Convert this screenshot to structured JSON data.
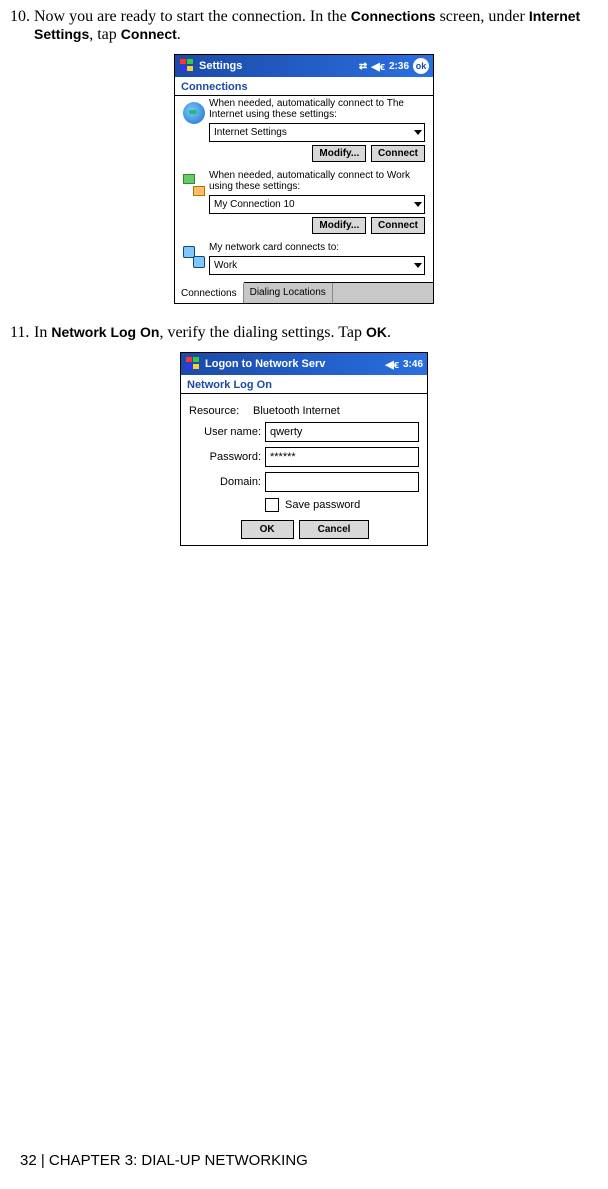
{
  "steps": {
    "step10_num": "10.",
    "step10_pre": "Now you are ready to start the connection. In the ",
    "step10_b1": "Connections",
    "step10_mid1": " screen, under ",
    "step10_b2": "Internet Settings",
    "step10_mid2": ", tap ",
    "step10_b3": "Connect",
    "step10_end": ".",
    "step11_num": "11.",
    "step11_pre": "In ",
    "step11_b1": "Network Log On",
    "step11_mid": ", verify the dialing settings. Tap ",
    "step11_b2": "OK",
    "step11_end": "."
  },
  "fig1": {
    "window_title": "Settings",
    "time": "2:36",
    "ok": "ok",
    "section_title": "Connections",
    "internet_text": "When needed, automatically connect to The Internet using these settings:",
    "internet_dd": "Internet Settings",
    "modify": "Modify...",
    "connect": "Connect",
    "work_text": "When needed, automatically connect to Work using these settings:",
    "work_dd": "My Connection 10",
    "card_text": "My network card connects to:",
    "card_dd": "Work",
    "tab1": "Connections",
    "tab2": "Dialing Locations"
  },
  "fig2": {
    "window_title": "Logon to Network Serv",
    "time": "3:46",
    "section_title": "Network Log On",
    "resource_label": "Resource:",
    "resource_value": "Bluetooth Internet",
    "user_label": "User name:",
    "user_value": "qwerty",
    "pass_label": "Password:",
    "pass_value": "******",
    "domain_label": "Domain:",
    "domain_value": "",
    "save_label": "Save password",
    "ok": "OK",
    "cancel": "Cancel"
  },
  "footer": "32 | CHAPTER 3: DIAL-UP NETWORKING"
}
